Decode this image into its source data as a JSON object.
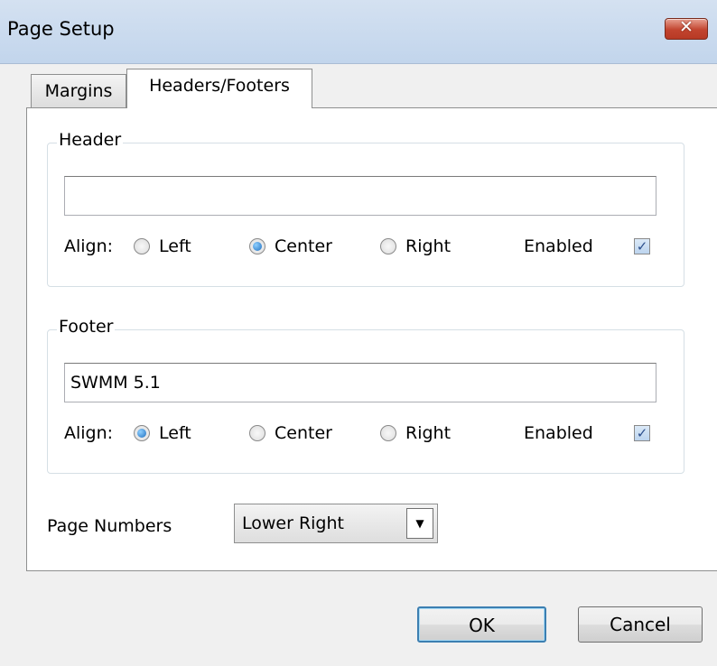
{
  "window": {
    "title": "Page Setup",
    "close_symbol": "✕"
  },
  "tabs": [
    {
      "label": "Margins",
      "active": false
    },
    {
      "label": "Headers/Footers",
      "active": true
    }
  ],
  "header": {
    "group_label": "Header",
    "text_value": "",
    "align_label": "Align:",
    "options": [
      "Left",
      "Center",
      "Right"
    ],
    "selected_align": "Center",
    "enabled_label": "Enabled",
    "enabled": true
  },
  "footer": {
    "group_label": "Footer",
    "text_value": "SWMM 5.1",
    "align_label": "Align:",
    "options": [
      "Left",
      "Center",
      "Right"
    ],
    "selected_align": "Left",
    "enabled_label": "Enabled",
    "enabled": true
  },
  "page_numbers": {
    "label": "Page Numbers",
    "selected": "Lower Right",
    "arrow": "▼"
  },
  "buttons": {
    "ok": "OK",
    "cancel": "Cancel"
  },
  "icons": {
    "close": "close-icon",
    "dropdown": "chevron-down-icon",
    "check": "checkmark-icon"
  },
  "check_symbol": "✓",
  "colors": {
    "titlebar": "#c9d6e6",
    "close_button": "#c2442f",
    "default_button_border": "#3c7fb1"
  }
}
